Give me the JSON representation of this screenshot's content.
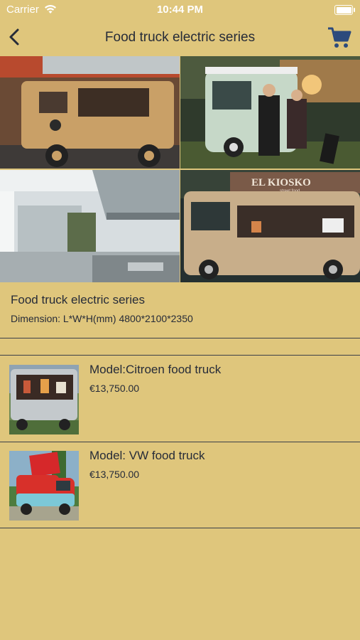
{
  "status": {
    "carrier": "Carrier",
    "time": "10:44 PM"
  },
  "nav": {
    "title": "Food truck electric series",
    "back_icon": "chevron-left-icon",
    "cart_icon": "cart-icon"
  },
  "hero": {
    "sign_text": "EL KIOSKO",
    "sign_sub": "street food"
  },
  "info": {
    "title": "Food truck electric series",
    "dimension": "Dimension: L*W*H(mm) 4800*2100*2350"
  },
  "products": [
    {
      "name": "Model:Citroen food truck",
      "price": "€13,750.00"
    },
    {
      "name": "Model: VW food truck",
      "price": "€13,750.00"
    }
  ],
  "colors": {
    "background": "#dfc67c",
    "text": "#262b38",
    "divider": "#3b3f48"
  }
}
